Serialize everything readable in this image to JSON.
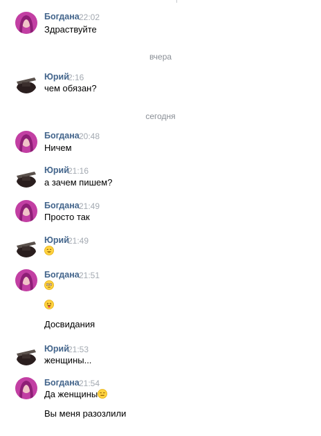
{
  "messages": [
    {
      "author": "Богдана",
      "time": "22:02",
      "lines": [
        "Здраствуйте"
      ]
    },
    {
      "author": "Юрий",
      "time": "2:16",
      "lines": [
        "чем обязан?"
      ]
    },
    {
      "author": "Богдана",
      "time": "20:48",
      "lines": [
        "Ничем"
      ]
    },
    {
      "author": "Юрий",
      "time": "21:16",
      "lines": [
        "а зачем пишем?"
      ]
    },
    {
      "author": "Богдана",
      "time": "21:49",
      "lines": [
        "Просто так"
      ]
    },
    {
      "author": "Юрий",
      "time": "21:49",
      "emoji": "smile-emoji"
    },
    {
      "author": "Богдана",
      "time": "21:51",
      "lines": [
        "Досвидания"
      ],
      "emoji": [
        "flushed-emoji",
        "tongue-emoji"
      ]
    },
    {
      "author": "Юрий",
      "time": "21:53",
      "lines": [
        "женщины..."
      ]
    },
    {
      "author": "Богдана",
      "time": "21:54",
      "lines": [
        "Да женщины",
        "Вы меня разозлили"
      ],
      "emoji": "expressionless-emoji"
    }
  ],
  "dividers": [
    "вчера",
    "сегодня"
  ],
  "colors": {
    "author": "#42648b",
    "time": "#a3a9b1",
    "divider": "#8a8f96",
    "emoji": "#ffd23f"
  }
}
